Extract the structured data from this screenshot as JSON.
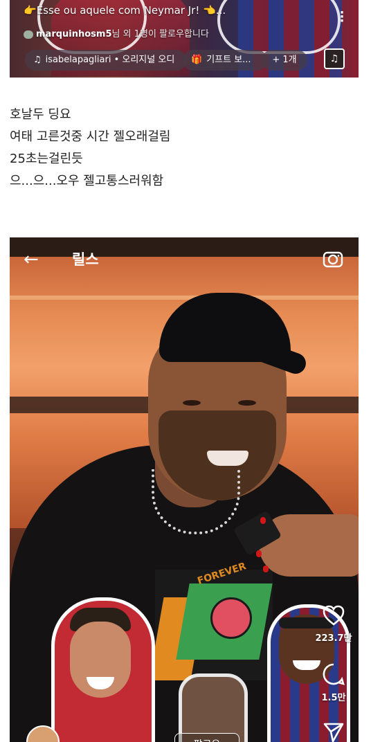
{
  "top_reel": {
    "caption": "Esse ou aquele com Neymar Jr!",
    "caption_emoji_left": "👉",
    "caption_emoji_right": "👈",
    "caption_ellipsis": "...",
    "follow_user": "marquinhosm5",
    "follow_suffix": "님 외 1명이 팔로우합니다",
    "chips": [
      {
        "icon": "music-note-icon",
        "glyph": "♫",
        "label": "isabelapagliari • 오리지널 오디"
      },
      {
        "icon": "gift-icon",
        "glyph": "🎁",
        "label": "기프트 보..."
      },
      {
        "icon": "",
        "glyph": "",
        "label": "+ 1개"
      }
    ],
    "music_glyph": "♫"
  },
  "body_text": [
    "호날두 딩요",
    "여태 고른것중 시간 젤오래걸림",
    "25초는걸린듯",
    "으...으...오우 젤고통스러워함"
  ],
  "reel": {
    "title": "릴스",
    "back_glyph": "←",
    "shirt_print": "FOREVER",
    "likes": "223.7만",
    "comments": "1.5만",
    "follow_label": "팔로우"
  },
  "colors": {
    "accent_red": "#d01818",
    "glow_orange": "#e58a52"
  }
}
